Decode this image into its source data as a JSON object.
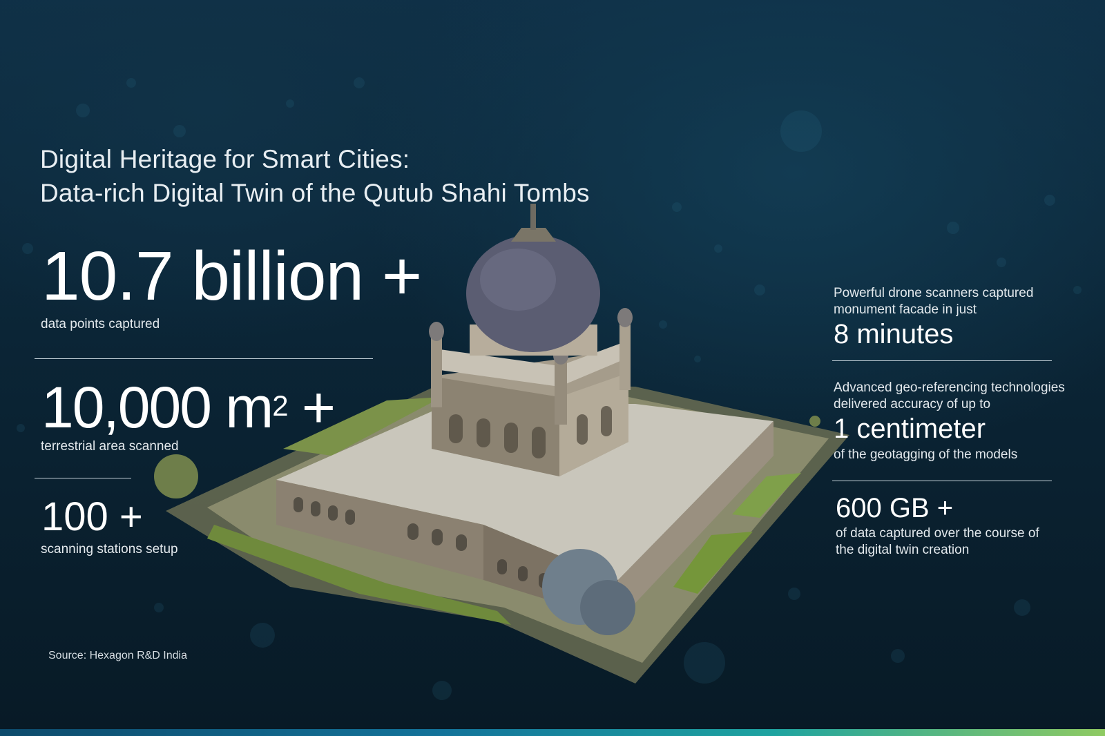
{
  "title": {
    "line1": "Digital Heritage for Smart Cities:",
    "line2": "Data-rich Digital Twin of the Qutub Shahi Tombs"
  },
  "left_stats": {
    "data_points": {
      "value": "10.7 billion +",
      "caption": "data points captured"
    },
    "area": {
      "value": "10,000 m",
      "superscript": "2",
      "suffix": " +",
      "caption": "terrestrial area scanned"
    },
    "stations": {
      "value": "100 +",
      "caption": "scanning stations setup"
    }
  },
  "right_stats": {
    "drone": {
      "line1": "Powerful drone scanners captured",
      "line2": "monument facade in just",
      "value": "8 minutes"
    },
    "geo": {
      "line1": "Advanced geo-referencing technologies",
      "line2": "delivered accuracy of up to",
      "value": "1 centimeter",
      "after": "of the geotagging of the models"
    },
    "data": {
      "value": "600 GB +",
      "line1": "of data captured over the course of",
      "line2": "the digital twin creation"
    }
  },
  "source": "Source: Hexagon R&D India",
  "colors": {
    "background": "#0b2536",
    "accent_bar_start": "#0d4a6b",
    "accent_bar_end": "#8fca62",
    "text": "#ffffff"
  }
}
